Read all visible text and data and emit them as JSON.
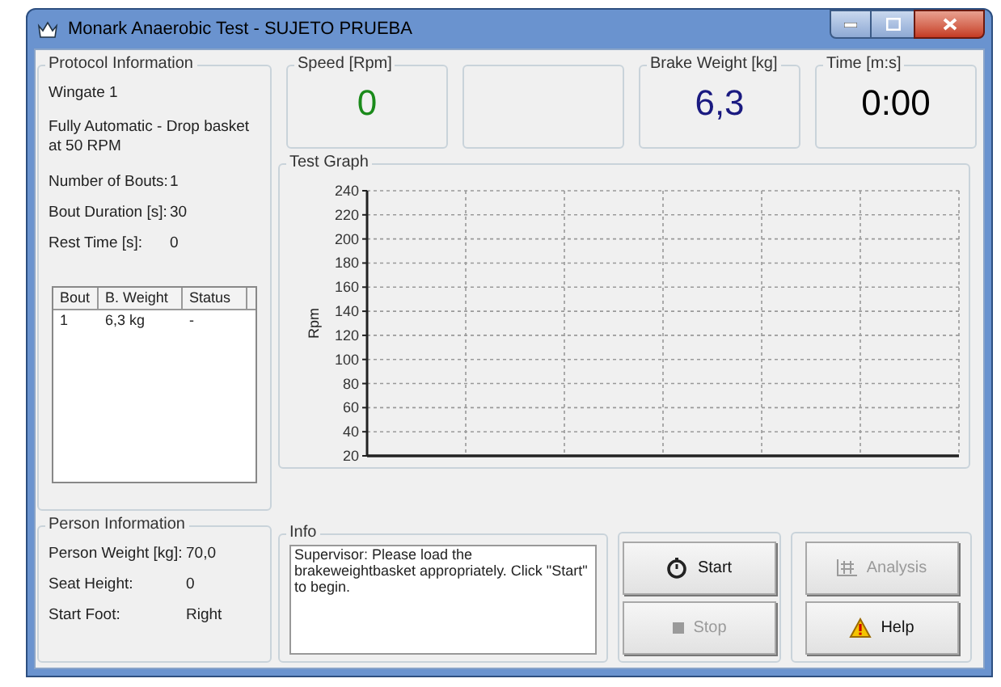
{
  "window": {
    "title": "Monark Anaerobic Test - SUJETO PRUEBA"
  },
  "protocol": {
    "title": "Protocol Information",
    "name": "Wingate 1",
    "mode": "Fully Automatic - Drop basket at 50 RPM",
    "fields": [
      {
        "label": "Number of Bouts:",
        "value": "1"
      },
      {
        "label": "Bout Duration [s]:",
        "value": "30"
      },
      {
        "label": "Rest Time [s]:",
        "value": "0"
      }
    ],
    "table": {
      "columns": [
        "Bout",
        "B. Weight",
        "Status"
      ],
      "rows": [
        [
          "1",
          "6,3 kg",
          "-"
        ]
      ]
    }
  },
  "person": {
    "title": "Person Information",
    "fields": [
      {
        "label": "Person Weight [kg]:",
        "value": "70,0"
      },
      {
        "label": "Seat Height:",
        "value": "0"
      },
      {
        "label": "Start Foot:",
        "value": "Right"
      }
    ]
  },
  "readouts": [
    {
      "label": "Speed [Rpm]",
      "value": "0",
      "color": "#1a8a1a"
    },
    {
      "kind": "blank"
    },
    {
      "label": "Brake Weight [kg]",
      "value": "6,3",
      "color": "#1a1a80"
    },
    {
      "label": "Time [m:s]",
      "value": "0:00",
      "color": "#000000"
    }
  ],
  "graph": {
    "title": "Test Graph",
    "chart_data": {
      "type": "line",
      "categories": [
        null,
        null,
        null,
        null,
        null,
        null
      ],
      "grid": true,
      "ylabel": "Rpm",
      "ylim": [
        20,
        240
      ],
      "yticks": [
        20,
        40,
        60,
        80,
        100,
        120,
        140,
        160,
        180,
        200,
        220,
        240
      ]
    }
  },
  "info": {
    "title": "Info",
    "text": "Supervisor: Please load the brakeweightbasket appropriately. Click \"Start\" to begin."
  },
  "buttons": [
    {
      "kind": "start",
      "label": "Start",
      "disabled": false
    },
    {
      "kind": "stop",
      "label": "Stop",
      "disabled": true
    },
    {
      "kind": "analysis",
      "label": "Analysis",
      "disabled": true
    },
    {
      "kind": "help",
      "label": "Help",
      "disabled": false
    }
  ]
}
